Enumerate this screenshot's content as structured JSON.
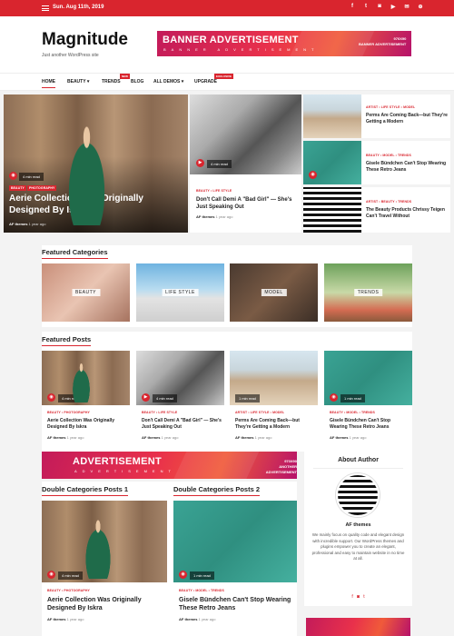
{
  "topbar": {
    "date": "Sun. Aug 11th, 2019",
    "social": [
      "f",
      "t",
      "◙",
      "▶",
      "✉",
      "⊕"
    ]
  },
  "header": {
    "logo": "Magnitude",
    "tagline": "Just another WordPress site",
    "banner_title": "BANNER ADVERTISEMENT",
    "banner_sub": "BANNER ADVERTISEMENT",
    "banner_size_1": "970X90",
    "banner_size_2": "BANNER ADVERTISEMENT"
  },
  "nav": {
    "items": [
      "HOME",
      "BEAUTY",
      "TRENDS",
      "BLOG",
      "ALL DEMOS",
      "UPGRADE"
    ],
    "badge_new": "NEW",
    "badge_exclusive": "EXCLUSIVE"
  },
  "hero": {
    "main": {
      "tags": [
        "BEAUTY",
        "PHOTOGRAPHY"
      ],
      "readtime": "4 min read",
      "title": "Aerie Collection Was Originally Designed By Iskra",
      "author": "AF themes",
      "time": "1 year ago"
    },
    "middle": {
      "readtime": "4 min read",
      "tags": [
        "BEAUTY",
        "LIFE STYLE"
      ],
      "title": "Don't Call Demi A \"Bad Girl\" — She's Just Speaking Out",
      "author": "AF themes",
      "time": "1 year ago"
    },
    "right": [
      {
        "tags": [
          "ARTIST",
          "LIFE STYLE",
          "MODEL"
        ],
        "title": "Perms Are Coming Back—but They're Getting a Modern"
      },
      {
        "tags": [
          "BEAUTY",
          "MODEL",
          "TRENDS"
        ],
        "title": "Gisele Bündchen Can't Stop Wearing These Retro Jeans"
      },
      {
        "tags": [
          "ARTIST",
          "BEAUTY",
          "TRENDS"
        ],
        "title": "The Beauty Products Chrissy Teigen Can't Travel Without"
      }
    ]
  },
  "featured_categories": {
    "title": "Featured Categories",
    "items": [
      "BEAUTY",
      "LIFE STYLE",
      "MODEL",
      "TRENDS"
    ]
  },
  "featured_posts": {
    "title": "Featured Posts",
    "items": [
      {
        "tags": [
          "BEAUTY",
          "PHOTOGRAPHY"
        ],
        "readtime": "4 min read",
        "title": "Aerie Collection Was Originally Designed By Iskra",
        "author": "AF themes",
        "time": "1 year ago"
      },
      {
        "tags": [
          "BEAUTY",
          "LIFE STYLE"
        ],
        "readtime": "4 min read",
        "title": "Don't Call Demi A \"Bad Girl\" — She's Just Speaking Out",
        "author": "AF themes",
        "time": "1 year ago"
      },
      {
        "tags": [
          "ARTIST",
          "LIFE STYLE",
          "MODEL"
        ],
        "readtime": "1 min read",
        "title": "Perms Are Coming Back—but They're Getting a Modern",
        "author": "AF themes",
        "time": "1 year ago"
      },
      {
        "tags": [
          "BEAUTY",
          "MODEL",
          "TRENDS"
        ],
        "readtime": "1 min read",
        "title": "Gisele Bündchen Can't Stop Wearing These Retro Jeans",
        "author": "AF themes",
        "time": "1 year ago"
      }
    ]
  },
  "ad": {
    "title": "ADVERTISEMENT",
    "sub": "ADVERTISEMENT",
    "size_1": "970X90",
    "size_2": "ANOTHER ADVERTISEMENT"
  },
  "double1": {
    "title": "Double Categories Posts 1",
    "tags": [
      "BEAUTY",
      "PHOTOGRAPHY"
    ],
    "readtime": "4 min read",
    "post": "Aerie Collection Was Originally Designed By Iskra",
    "author": "AF themes",
    "time": "1 year ago"
  },
  "double2": {
    "title": "Double Categories Posts 2",
    "tags": [
      "BEAUTY",
      "MODEL",
      "TRENDS"
    ],
    "readtime": "1 min read",
    "post": "Gisele Bündchen Can't Stop Wearing These Retro Jeans",
    "author": "AF themes",
    "time": "1 year ago"
  },
  "about": {
    "title": "About Author",
    "name": "AF themes",
    "desc": "We mainly focus on quality code and elegant design with incredible support. Our WordPress themes and plugins empower you to create an elegant, professional and easy to maintain website in no time at all.",
    "social": [
      "f",
      "◙",
      "t"
    ]
  },
  "colors": {
    "accent": "#d9252e"
  }
}
